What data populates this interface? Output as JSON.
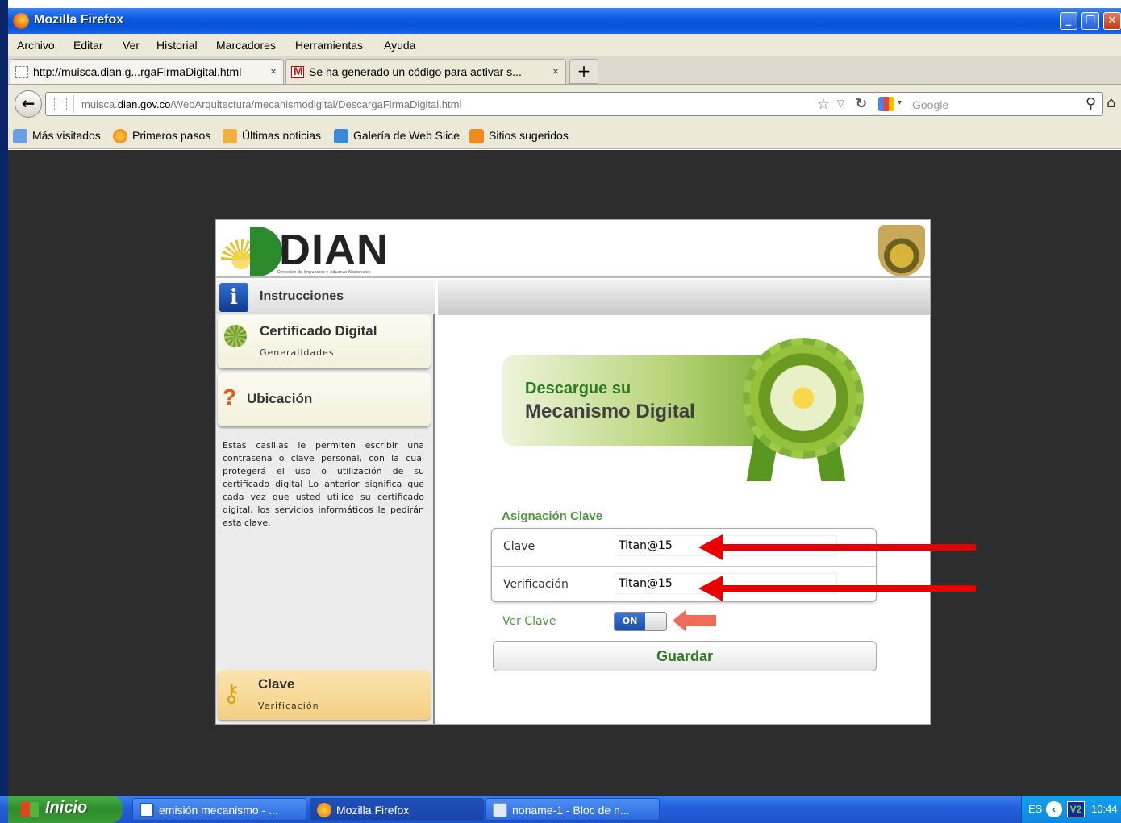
{
  "window": {
    "title": "Mozilla Firefox"
  },
  "menu": [
    "Archivo",
    "Editar",
    "Ver",
    "Historial",
    "Marcadores",
    "Herramientas",
    "Ayuda"
  ],
  "tabs": [
    {
      "label": "http://muisca.dian.g...rgaFirmaDigital.html",
      "close": "×"
    },
    {
      "label": "Se ha generado un código para activar s...",
      "close": "×"
    }
  ],
  "new_tab": "+",
  "nav": {
    "url_prefix": "muisca.",
    "url_domain": "dian.gov.co",
    "url_path": "/WebArquitectura/mecanismodigital/DescargaFirmaDigital.html",
    "search_placeholder": "Google"
  },
  "bookmarks": [
    "Más visitados",
    "Primeros pasos",
    "Últimas noticias",
    "Galería de Web Slice",
    "Sitios sugeridos"
  ],
  "page": {
    "logo_text": "DIAN",
    "logo_subtitle": "Dirección de Impuestos y Aduanas Nacionales",
    "sidebar": {
      "instructions_label": "Instrucciones",
      "cert_title": "Certificado Digital",
      "cert_sub": "Generalidades",
      "ubic_title": "Ubicación",
      "description": "Estas casillas le permiten escribir una contraseña o clave personal, con la cual protegerá el uso o utilización de su certificado digital Lo anterior significa que cada vez que usted utilice su certificado digital, los servicios informáticos le pedirán esta clave.",
      "clave_title": "Clave",
      "clave_sub": "Verificación"
    },
    "banner_line1": "Descargue su",
    "banner_line2": "Mecanismo Digital",
    "section_label": "Asignación Clave",
    "fields": {
      "clave_label": "Clave",
      "clave_value": "Titan@15",
      "verif_label": "Verificación",
      "verif_value": "Titan@15"
    },
    "ver_clave_label": "Ver Clave",
    "toggle_state": "ON",
    "save_label": "Guardar"
  },
  "taskbar": {
    "start": "Inicio",
    "items": [
      "emisión mecanismo - ...",
      "Mozilla Firefox",
      "noname-1 - Bloc de n..."
    ],
    "lang": "ES",
    "clock": "10:44"
  }
}
